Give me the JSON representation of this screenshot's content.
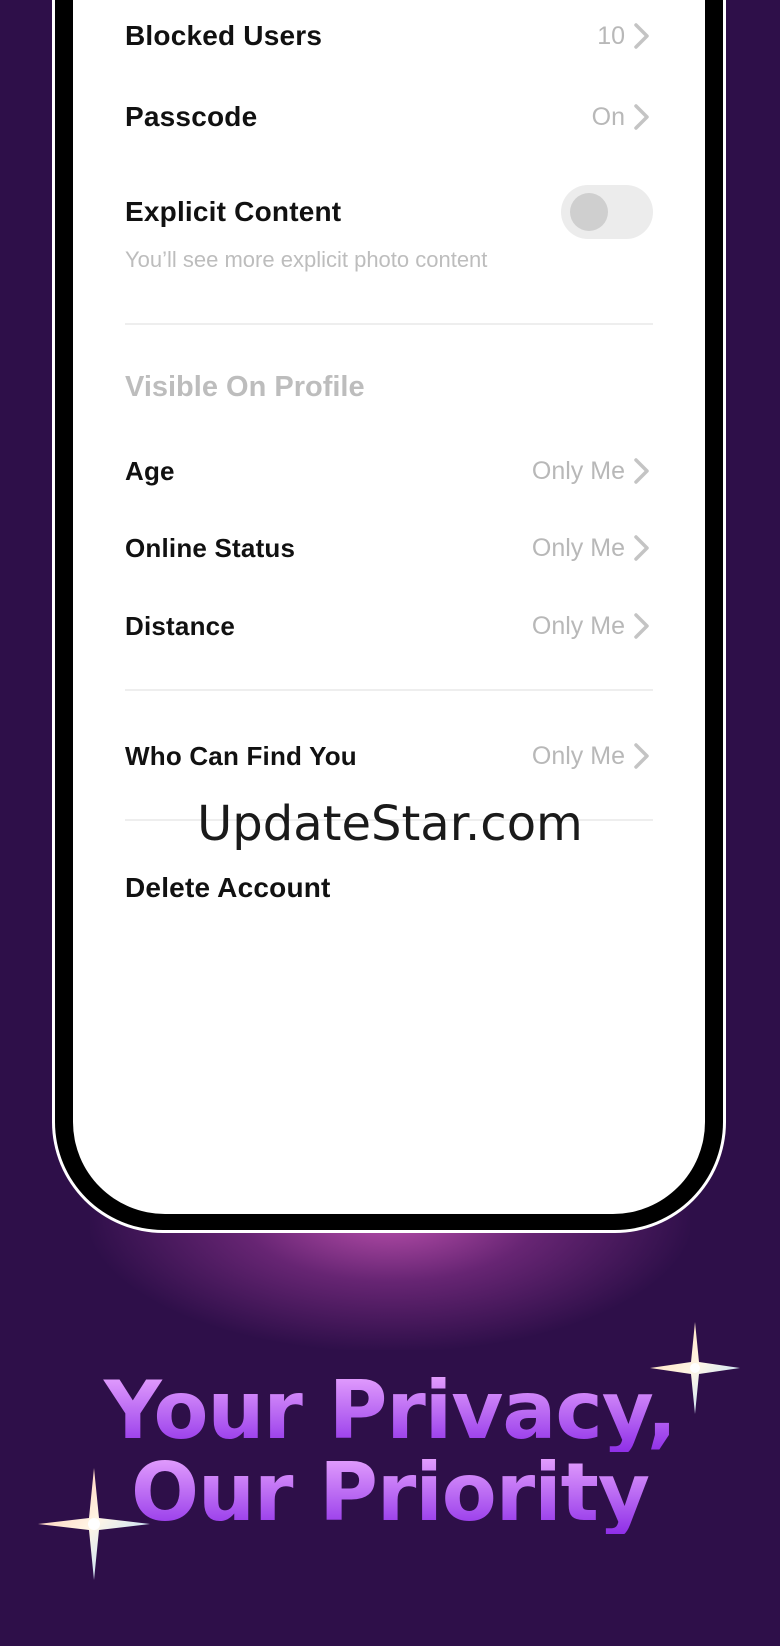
{
  "settings": {
    "blocked_users": {
      "label": "Blocked Users",
      "value": "10"
    },
    "passcode": {
      "label": "Passcode",
      "value": "On"
    },
    "explicit_content": {
      "label": "Explicit Content",
      "hint": "You’ll see more explicit photo content",
      "enabled": false
    },
    "visible_section_title": "Visible On Profile",
    "age": {
      "label": "Age",
      "value": "Only Me"
    },
    "online_status": {
      "label": "Online Status",
      "value": "Only Me"
    },
    "distance": {
      "label": "Distance",
      "value": "Only Me"
    },
    "who_can_find": {
      "label": "Who Can Find You",
      "value": "Only Me"
    },
    "delete_account": {
      "label": "Delete Account"
    }
  },
  "watermark": "UpdateStar.com",
  "headline": {
    "line1": "Your Privacy,",
    "line2": "Our Priority"
  },
  "icons": {
    "chevron": "chevron-right-icon",
    "sparkle": "sparkle-star-icon"
  },
  "colors": {
    "background": "#2e0f49",
    "headline_top": "#e9a6ff",
    "headline_bottom": "#8f2fe8",
    "value_gray": "#b8b8b8"
  }
}
